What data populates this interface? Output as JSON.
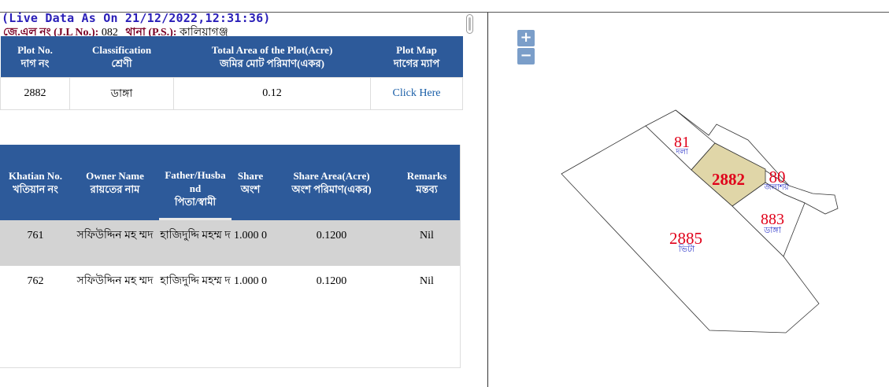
{
  "live_data": "(Live Data As On 21/12/2022,12:31:36)",
  "jl": {
    "label": "জে.এল নং (J.L No.):",
    "value": "082",
    "ps_label": "থানা (P.S.):",
    "ps_value": "কালিয়াগঞ্জ"
  },
  "plot_table": {
    "headers": [
      {
        "en": "Plot No.",
        "bn": "দাগ নং"
      },
      {
        "en": "Classification",
        "bn": "শ্রেণী"
      },
      {
        "en": "Total Area of the Plot(Acre)",
        "bn": "জমির মোট পরিমাণ(একর)"
      },
      {
        "en": "Plot Map",
        "bn": "দাগের ম্যাপ"
      }
    ],
    "row": {
      "plot_no": "2882",
      "classification": "ডাঙ্গা",
      "area": "0.12",
      "map_link": "Click Here"
    }
  },
  "owner_table": {
    "headers": [
      {
        "en": "Khatian No.",
        "bn": "খতিয়ান নং"
      },
      {
        "en": "Owner Name",
        "bn": "রায়তের নাম"
      },
      {
        "en": "Father/Husba nd",
        "bn": "পিতা/স্বামী"
      },
      {
        "en": "Share",
        "bn": "অংশ"
      },
      {
        "en": "Share Area(Acre)",
        "bn": "অংশ পরিমাণ(একর)"
      },
      {
        "en": "Remarks",
        "bn": "মন্তব্য"
      }
    ],
    "rows": [
      {
        "khatian": "761",
        "owner": "সফিউদ্দিন মহ ম্মদ",
        "father": "হাজিদুদ্দি মহম্ম দ",
        "share": "1.000 0",
        "share_area": "0.1200",
        "remarks": "Nil"
      },
      {
        "khatian": "762",
        "owner": "সফিউদ্দিন মহ ম্মদ",
        "father": "হাজিদুদ্দি মহম্ম দ",
        "share": "1.000 0",
        "share_area": "0.1200",
        "remarks": "Nil"
      }
    ]
  },
  "map": {
    "zoom_in": "+",
    "zoom_out": "−",
    "highlight_color": "#e0d6a8",
    "plots": [
      {
        "no": "81",
        "class": "দলা"
      },
      {
        "no": "2882",
        "class": ""
      },
      {
        "no": "80",
        "class": "জলাশয়"
      },
      {
        "no": "883",
        "class": "ডাঙ্গা"
      },
      {
        "no": "2885",
        "class": "ভিটা"
      }
    ]
  }
}
